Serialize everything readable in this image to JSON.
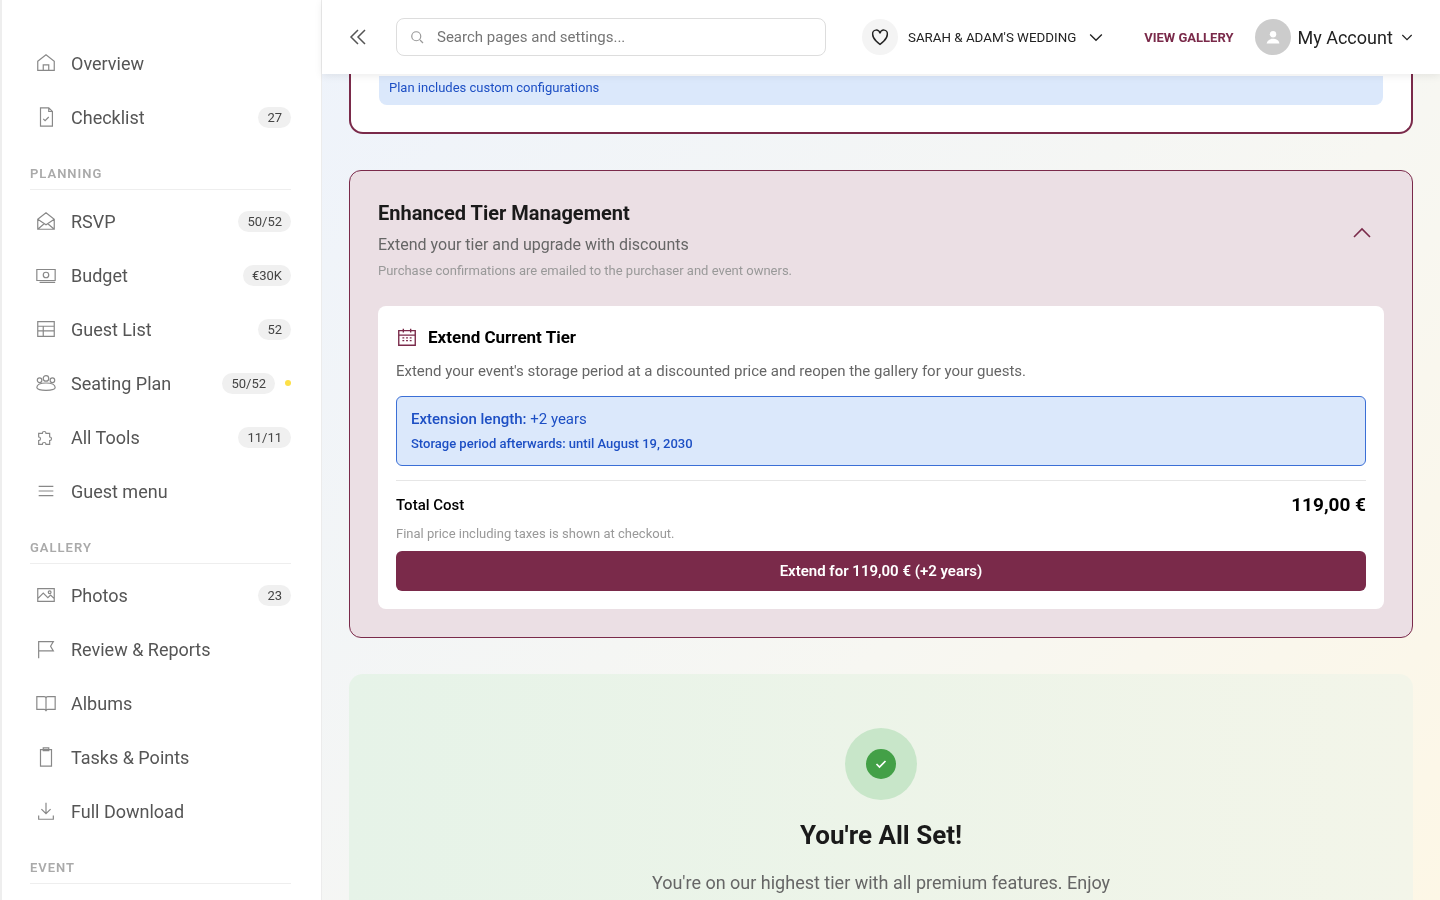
{
  "sidebar": {
    "sections": [
      {
        "items": [
          {
            "label": "Overview"
          },
          {
            "label": "Checklist",
            "badge": "27"
          }
        ]
      },
      {
        "heading": "PLANNING",
        "items": [
          {
            "label": "RSVP",
            "badge": "50/52"
          },
          {
            "label": "Budget",
            "badge": "€30K"
          },
          {
            "label": "Guest List",
            "badge": "52"
          },
          {
            "label": "Seating Plan",
            "badge": "50/52",
            "color": "#fde047"
          },
          {
            "label": "All Tools",
            "badge": "11/11"
          },
          {
            "label": "Guest menu"
          }
        ]
      },
      {
        "heading": "GALLERY",
        "items": [
          {
            "label": "Photos",
            "badge": "23"
          },
          {
            "label": "Review & Reports"
          },
          {
            "label": "Albums"
          },
          {
            "label": "Tasks & Points"
          },
          {
            "label": "Full Download"
          }
        ]
      },
      {
        "heading": "EVENT"
      }
    ]
  },
  "header": {
    "search": {
      "placeholder": "Search pages and settings..."
    },
    "event": "SARAH & ADAM'S WEDDING",
    "view_gallery": "VIEW GALLERY",
    "account": "My Account"
  },
  "plan_note": "Plan includes custom configurations",
  "tier": {
    "title": "Enhanced Tier Management",
    "subtitle": "Extend your tier and upgrade with discounts",
    "note": "Purchase confirmations are emailed to the purchaser and event owners.",
    "expanded": true,
    "extend": {
      "title": "Extend Current Tier",
      "description": "Extend your event's storage period at a discounted price and reopen the gallery for your guests.",
      "length": "**Extension length:** +2 years",
      "storage": "Storage period afterwards: until August 19, 2030",
      "total_label": "Total Cost",
      "total": "119,00 €",
      "price_note": "Final price including taxes is shown at checkout.",
      "button": "Extend for 119,00 € (+2 years)"
    }
  },
  "all_set": {
    "title": "You're All Set!",
    "text": "You're on our highest tier with all premium features. Enjoy"
  }
}
